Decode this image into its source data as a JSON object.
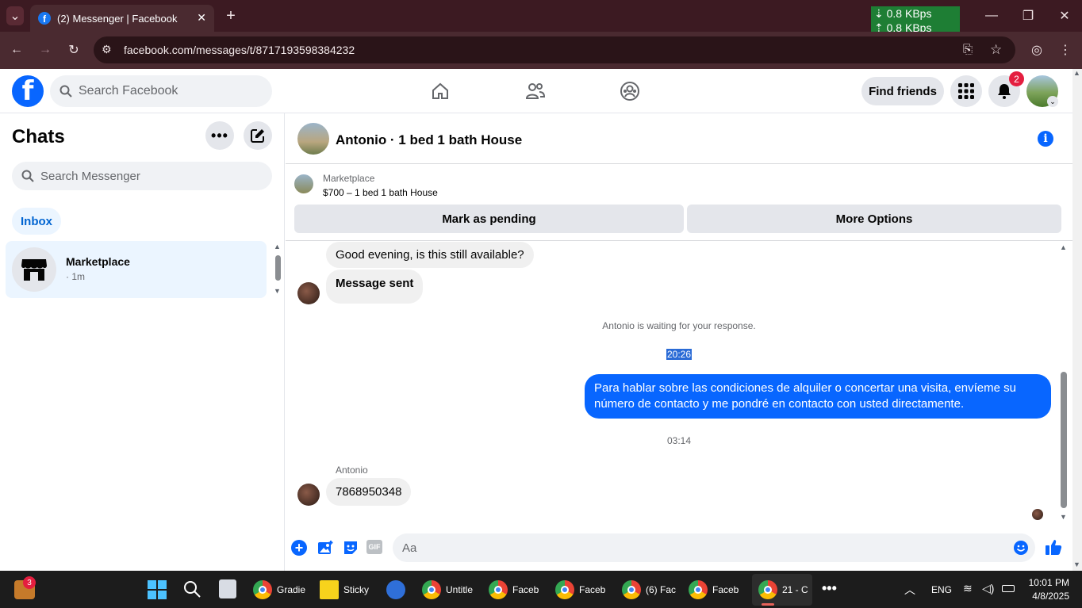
{
  "browser": {
    "tab_title": "(2) Messenger | Facebook",
    "url": "facebook.com/messages/t/8717193598384232",
    "net_down": "0.8 KBps",
    "net_up": "0.8 KBps"
  },
  "fb": {
    "search_placeholder": "Search Facebook",
    "find_friends": "Find friends",
    "notif_count": "2"
  },
  "left": {
    "title": "Chats",
    "search_placeholder": "Search Messenger",
    "inbox_label": "Inbox",
    "conversations": [
      {
        "name": "Marketplace",
        "time": "· 1m"
      }
    ]
  },
  "chat": {
    "header_name": "Antonio · 1 bed 1 bath House",
    "marketplace_label": "Marketplace",
    "listing_title": "$700 – 1 bed 1 bath House",
    "mark_pending": "Mark as pending",
    "more_options": "More Options",
    "messages": {
      "m1": "Good evening, is this still available?",
      "m2": "Message sent",
      "waiting_note": "Antonio is waiting for your response.",
      "time1": "20:26",
      "m3": "Para hablar sobre las condiciones de alquiler o concertar una visita, envíeme su número de contacto y me pondré en contacto con usted directamente.",
      "time2": "03:14",
      "sender": "Antonio",
      "m4": "7868950348"
    },
    "composer_placeholder": "Aa"
  },
  "taskbar": {
    "widget_badge": "3",
    "apps": [
      {
        "label": "Gradie"
      },
      {
        "label": "Sticky"
      },
      {
        "label": "Untitle"
      },
      {
        "label": "Faceb"
      },
      {
        "label": "Faceb"
      },
      {
        "label": "(6) Fac"
      },
      {
        "label": "Faceb"
      },
      {
        "label": "21 - C"
      }
    ],
    "lang": "ENG",
    "time": "10:01 PM",
    "date": "4/8/2025"
  }
}
